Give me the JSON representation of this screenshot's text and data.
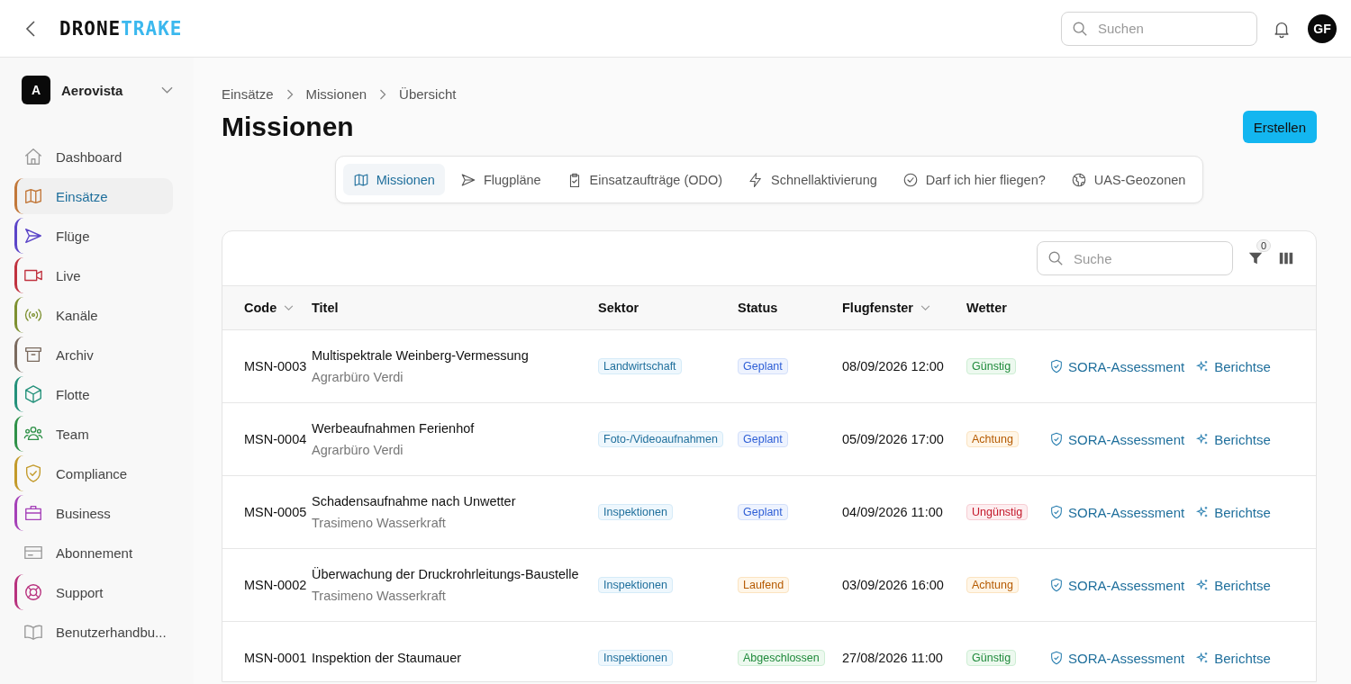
{
  "header": {
    "logo_left": "DRONE",
    "logo_right": "TRAKE",
    "search": {
      "placeholder": "Suchen"
    },
    "avatar": "GF"
  },
  "sidebar": {
    "org": {
      "initial": "A",
      "name": "Aerovista"
    },
    "items": [
      {
        "label": "Dashboard",
        "selected": false
      },
      {
        "label": "Einsätze",
        "selected": true,
        "color": "#c2783a"
      },
      {
        "label": "Flüge",
        "selected": false,
        "color": "#5b45c8"
      },
      {
        "label": "Live",
        "selected": false,
        "color": "#c0323f"
      },
      {
        "label": "Kanäle",
        "selected": false,
        "color": "#7d9030"
      },
      {
        "label": "Archiv",
        "selected": false,
        "color": "#7a6a5e"
      },
      {
        "label": "Flotte",
        "selected": false,
        "color": "#23917a"
      },
      {
        "label": "Team",
        "selected": false,
        "color": "#2f9148"
      },
      {
        "label": "Compliance",
        "selected": false,
        "color": "#c39a2a"
      },
      {
        "label": "Business",
        "selected": false,
        "color": "#a541b8"
      },
      {
        "label": "Abonnement",
        "selected": false
      },
      {
        "label": "Support",
        "selected": false,
        "color": "#b8327e"
      },
      {
        "label": "Benutzerhandbu...",
        "selected": false
      }
    ]
  },
  "breadcrumbs": [
    "Einsätze",
    "Missionen",
    "Übersicht"
  ],
  "page_title": "Missionen",
  "create_button": "Erstellen",
  "tabs": [
    {
      "label": "Missionen",
      "selected": true
    },
    {
      "label": "Flugpläne",
      "selected": false
    },
    {
      "label": "Einsatzaufträge (ODO)",
      "selected": false
    },
    {
      "label": "Schnellaktivierung",
      "selected": false
    },
    {
      "label": "Darf ich hier fliegen?",
      "selected": false
    },
    {
      "label": "UAS-Geozonen",
      "selected": false
    }
  ],
  "table": {
    "search": {
      "placeholder": "Suche"
    },
    "filter_count": "0",
    "columns": [
      {
        "label": "Code",
        "sortable": true
      },
      {
        "label": "Titel",
        "sortable": false
      },
      {
        "label": "Sektor",
        "sortable": false
      },
      {
        "label": "Status",
        "sortable": false
      },
      {
        "label": "Flugfenster",
        "sortable": true
      },
      {
        "label": "Wetter",
        "sortable": false
      }
    ],
    "rows": [
      {
        "code": "MSN-0003",
        "title": "Multispektrale Weinberg-Vermessung",
        "client": "Agrarbüro Verdi",
        "sector": "Landwirtschaft",
        "status": {
          "label": "Geplant",
          "kind": "planned"
        },
        "window": "08/09/2026 12:00",
        "weather": {
          "label": "Günstig",
          "kind": "good"
        },
        "action_1": "SORA-Assessment",
        "action_2": "Berichtse"
      },
      {
        "code": "MSN-0004",
        "title": "Werbeaufnahmen Ferienhof",
        "client": "Agrarbüro Verdi",
        "sector": "Foto-/Videoaufnahmen",
        "status": {
          "label": "Geplant",
          "kind": "planned"
        },
        "window": "05/09/2026 17:00",
        "weather": {
          "label": "Achtung",
          "kind": "warn"
        },
        "action_1": "SORA-Assessment",
        "action_2": "Berichtse"
      },
      {
        "code": "MSN-0005",
        "title": "Schadensaufnahme nach Unwetter",
        "client": "Trasimeno Wasserkraft",
        "sector": "Inspektionen",
        "status": {
          "label": "Geplant",
          "kind": "planned"
        },
        "window": "04/09/2026 11:00",
        "weather": {
          "label": "Ungünstig",
          "kind": "bad"
        },
        "action_1": "SORA-Assessment",
        "action_2": "Berichtse"
      },
      {
        "code": "MSN-0002",
        "title": "Überwachung der Druckrohrleitungs-Baustelle",
        "client": "Trasimeno Wasserkraft",
        "sector": "Inspektionen",
        "status": {
          "label": "Laufend",
          "kind": "running"
        },
        "window": "03/09/2026 16:00",
        "weather": {
          "label": "Achtung",
          "kind": "warn"
        },
        "action_1": "SORA-Assessment",
        "action_2": "Berichtse"
      },
      {
        "code": "MSN-0001",
        "title": "Inspektion der Staumauer",
        "sector": "Inspektionen",
        "status": {
          "label": "Abgeschlossen",
          "kind": "done"
        },
        "window": "27/08/2026 11:00",
        "weather": {
          "label": "Günstig",
          "kind": "good"
        },
        "action_1": "SORA-Assessment",
        "action_2": "Berichtse"
      }
    ]
  }
}
